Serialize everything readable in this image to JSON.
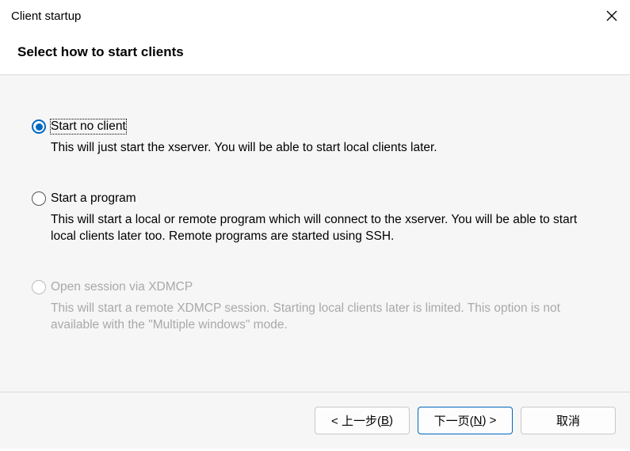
{
  "window": {
    "title": "Client startup"
  },
  "header": {
    "title": "Select how to start clients"
  },
  "options": [
    {
      "label": "Start no client",
      "description": "This will just start the xserver. You will be able to start local clients later.",
      "selected": true,
      "disabled": false
    },
    {
      "label": "Start a program",
      "description": "This will start a local or remote program which will connect to the xserver. You will be able to start local clients later too. Remote programs are started using SSH.",
      "selected": false,
      "disabled": false
    },
    {
      "label": "Open session via XDMCP",
      "description": "This will start a remote XDMCP session. Starting local clients later is limited. This option is not available with the \"Multiple windows\" mode.",
      "selected": false,
      "disabled": true
    }
  ],
  "footer": {
    "back": {
      "prefix": "< 上一步(",
      "mnemonic": "B",
      "suffix": ")"
    },
    "next": {
      "prefix": "下一页(",
      "mnemonic": "N",
      "suffix": ") >"
    },
    "cancel": "取消"
  }
}
